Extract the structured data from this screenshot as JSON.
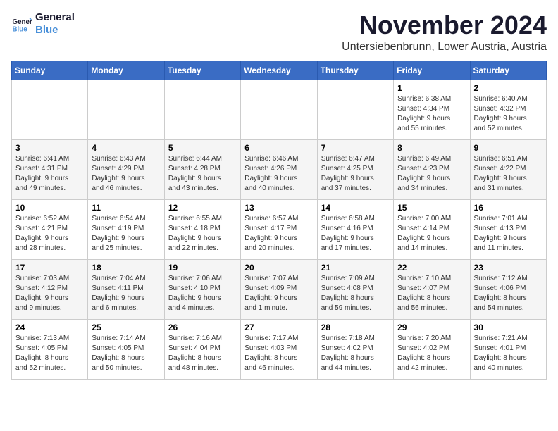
{
  "logo": {
    "line1": "General",
    "line2": "Blue"
  },
  "header": {
    "month_year": "November 2024",
    "location": "Untersiebenbrunn, Lower Austria, Austria"
  },
  "weekdays": [
    "Sunday",
    "Monday",
    "Tuesday",
    "Wednesday",
    "Thursday",
    "Friday",
    "Saturday"
  ],
  "weeks": [
    [
      {
        "day": "",
        "detail": ""
      },
      {
        "day": "",
        "detail": ""
      },
      {
        "day": "",
        "detail": ""
      },
      {
        "day": "",
        "detail": ""
      },
      {
        "day": "",
        "detail": ""
      },
      {
        "day": "1",
        "detail": "Sunrise: 6:38 AM\nSunset: 4:34 PM\nDaylight: 9 hours\nand 55 minutes."
      },
      {
        "day": "2",
        "detail": "Sunrise: 6:40 AM\nSunset: 4:32 PM\nDaylight: 9 hours\nand 52 minutes."
      }
    ],
    [
      {
        "day": "3",
        "detail": "Sunrise: 6:41 AM\nSunset: 4:31 PM\nDaylight: 9 hours\nand 49 minutes."
      },
      {
        "day": "4",
        "detail": "Sunrise: 6:43 AM\nSunset: 4:29 PM\nDaylight: 9 hours\nand 46 minutes."
      },
      {
        "day": "5",
        "detail": "Sunrise: 6:44 AM\nSunset: 4:28 PM\nDaylight: 9 hours\nand 43 minutes."
      },
      {
        "day": "6",
        "detail": "Sunrise: 6:46 AM\nSunset: 4:26 PM\nDaylight: 9 hours\nand 40 minutes."
      },
      {
        "day": "7",
        "detail": "Sunrise: 6:47 AM\nSunset: 4:25 PM\nDaylight: 9 hours\nand 37 minutes."
      },
      {
        "day": "8",
        "detail": "Sunrise: 6:49 AM\nSunset: 4:23 PM\nDaylight: 9 hours\nand 34 minutes."
      },
      {
        "day": "9",
        "detail": "Sunrise: 6:51 AM\nSunset: 4:22 PM\nDaylight: 9 hours\nand 31 minutes."
      }
    ],
    [
      {
        "day": "10",
        "detail": "Sunrise: 6:52 AM\nSunset: 4:21 PM\nDaylight: 9 hours\nand 28 minutes."
      },
      {
        "day": "11",
        "detail": "Sunrise: 6:54 AM\nSunset: 4:19 PM\nDaylight: 9 hours\nand 25 minutes."
      },
      {
        "day": "12",
        "detail": "Sunrise: 6:55 AM\nSunset: 4:18 PM\nDaylight: 9 hours\nand 22 minutes."
      },
      {
        "day": "13",
        "detail": "Sunrise: 6:57 AM\nSunset: 4:17 PM\nDaylight: 9 hours\nand 20 minutes."
      },
      {
        "day": "14",
        "detail": "Sunrise: 6:58 AM\nSunset: 4:16 PM\nDaylight: 9 hours\nand 17 minutes."
      },
      {
        "day": "15",
        "detail": "Sunrise: 7:00 AM\nSunset: 4:14 PM\nDaylight: 9 hours\nand 14 minutes."
      },
      {
        "day": "16",
        "detail": "Sunrise: 7:01 AM\nSunset: 4:13 PM\nDaylight: 9 hours\nand 11 minutes."
      }
    ],
    [
      {
        "day": "17",
        "detail": "Sunrise: 7:03 AM\nSunset: 4:12 PM\nDaylight: 9 hours\nand 9 minutes."
      },
      {
        "day": "18",
        "detail": "Sunrise: 7:04 AM\nSunset: 4:11 PM\nDaylight: 9 hours\nand 6 minutes."
      },
      {
        "day": "19",
        "detail": "Sunrise: 7:06 AM\nSunset: 4:10 PM\nDaylight: 9 hours\nand 4 minutes."
      },
      {
        "day": "20",
        "detail": "Sunrise: 7:07 AM\nSunset: 4:09 PM\nDaylight: 9 hours\nand 1 minute."
      },
      {
        "day": "21",
        "detail": "Sunrise: 7:09 AM\nSunset: 4:08 PM\nDaylight: 8 hours\nand 59 minutes."
      },
      {
        "day": "22",
        "detail": "Sunrise: 7:10 AM\nSunset: 4:07 PM\nDaylight: 8 hours\nand 56 minutes."
      },
      {
        "day": "23",
        "detail": "Sunrise: 7:12 AM\nSunset: 4:06 PM\nDaylight: 8 hours\nand 54 minutes."
      }
    ],
    [
      {
        "day": "24",
        "detail": "Sunrise: 7:13 AM\nSunset: 4:05 PM\nDaylight: 8 hours\nand 52 minutes."
      },
      {
        "day": "25",
        "detail": "Sunrise: 7:14 AM\nSunset: 4:05 PM\nDaylight: 8 hours\nand 50 minutes."
      },
      {
        "day": "26",
        "detail": "Sunrise: 7:16 AM\nSunset: 4:04 PM\nDaylight: 8 hours\nand 48 minutes."
      },
      {
        "day": "27",
        "detail": "Sunrise: 7:17 AM\nSunset: 4:03 PM\nDaylight: 8 hours\nand 46 minutes."
      },
      {
        "day": "28",
        "detail": "Sunrise: 7:18 AM\nSunset: 4:02 PM\nDaylight: 8 hours\nand 44 minutes."
      },
      {
        "day": "29",
        "detail": "Sunrise: 7:20 AM\nSunset: 4:02 PM\nDaylight: 8 hours\nand 42 minutes."
      },
      {
        "day": "30",
        "detail": "Sunrise: 7:21 AM\nSunset: 4:01 PM\nDaylight: 8 hours\nand 40 minutes."
      }
    ]
  ]
}
